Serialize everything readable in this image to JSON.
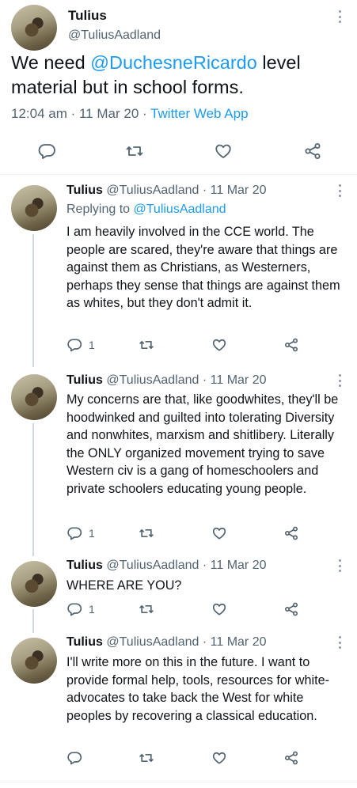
{
  "main_tweet": {
    "name": "Tulius",
    "handle": "@TuliusAadland",
    "text_before": "We need ",
    "mention": "@DuchesneRicardo",
    "text_after": " level material but in school forms.",
    "time": "12:04 am · 11 Mar 20 · ",
    "source": "Twitter Web App"
  },
  "replies": [
    {
      "name": "Tulius",
      "handle": "@TuliusAadland",
      "date": "· 11 Mar 20",
      "replying_label": "Replying to ",
      "replying_handle": "@TuliusAadland",
      "text": "I am heavily involved in the CCE world. The people are scared, they're aware that things are against them as Christians, as Westerners, perhaps they sense that things are against them as whites, but they don't admit it.",
      "reply_count": "1"
    },
    {
      "name": "Tulius",
      "handle": "@TuliusAadland",
      "date": "· 11 Mar 20",
      "text": "My concerns are that, like goodwhites, they'll be hoodwinked and guilted into tolerating Diversity and nonwhites, marxism and shitlibery. Literally the ONLY organized movement trying to save Western civ is a gang of homeschoolers and private schoolers educating young people.",
      "reply_count": "1"
    },
    {
      "name": "Tulius",
      "handle": "@TuliusAadland",
      "date": "· 11 Mar 20",
      "text": "WHERE ARE YOU?",
      "reply_count": "1"
    },
    {
      "name": "Tulius",
      "handle": "@TuliusAadland",
      "date": "· 11 Mar 20",
      "text": "I'll write more on this in the future. I want to provide formal help, tools, resources for white-advocates to take back the West for white peoples by recovering a classical education.",
      "reply_count": ""
    }
  ],
  "icons": {
    "reply": "reply-icon",
    "retweet": "retweet-icon",
    "like": "heart-icon",
    "share": "share-icon",
    "more": "more-options-icon"
  },
  "colors": {
    "link": "#1d9bf0",
    "secondary_text": "#536471",
    "thread_line": "#cfd9de"
  }
}
